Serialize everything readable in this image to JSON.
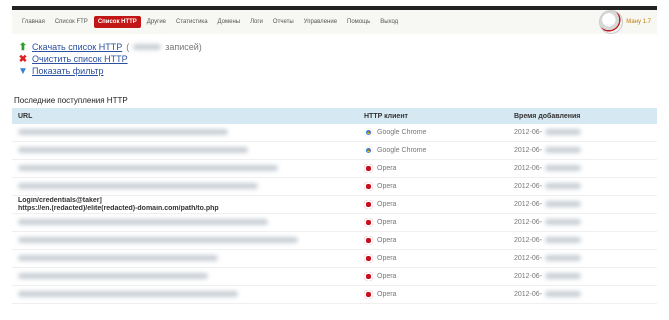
{
  "nav": {
    "items": [
      "Главная",
      "Список FTP",
      "Список HTTP",
      "Другие",
      "Статистика",
      "Домены",
      "Логи",
      "Отчеты",
      "Управление",
      "Помощь",
      "Выход"
    ],
    "active_index": 2
  },
  "user": {
    "name": "Ману 1.7"
  },
  "actions": {
    "download_label": "Скачать список HTTP",
    "download_count_prefix": "(",
    "download_count_suffix": "записей)",
    "clear_label": "Очистить список HTTP",
    "filter_label": "Показать фильтр"
  },
  "section_title": "Последние поступления HTTP",
  "table": {
    "headers": {
      "url": "URL",
      "client": "HTTP клиент",
      "time": "Время добавления"
    },
    "rows": [
      {
        "client": "Google Chrome",
        "client_icon": "chrome-icon",
        "time_prefix": "2012-06-"
      },
      {
        "client": "Google Chrome",
        "client_icon": "chrome-icon",
        "time_prefix": "2012-06-"
      },
      {
        "client": "Opera",
        "client_icon": "opera-icon",
        "time_prefix": "2012-06-"
      },
      {
        "client": "Opera",
        "client_icon": "opera-icon",
        "time_prefix": "2012-06-"
      },
      {
        "client": "Opera",
        "client_icon": "opera-icon",
        "time_prefix": "2012-06-",
        "url_line1": "Login/credentials@taker]",
        "url_line2": "https://en.(redacted)/elite(redacted)-domain.com/path/to.php"
      },
      {
        "client": "Opera",
        "client_icon": "opera-icon",
        "time_prefix": "2012-06-"
      },
      {
        "client": "Opera",
        "client_icon": "opera-icon",
        "time_prefix": "2012-06-"
      },
      {
        "client": "Opera",
        "client_icon": "opera-icon",
        "time_prefix": "2012-06-"
      },
      {
        "client": "Opera",
        "client_icon": "opera-icon",
        "time_prefix": "2012-06-"
      },
      {
        "client": "Opera",
        "client_icon": "opera-icon",
        "time_prefix": "2012-06-"
      }
    ]
  },
  "colors": {
    "active_tab": "#c21616",
    "header_bg": "#d6e8f1",
    "link": "#2b50a0"
  }
}
